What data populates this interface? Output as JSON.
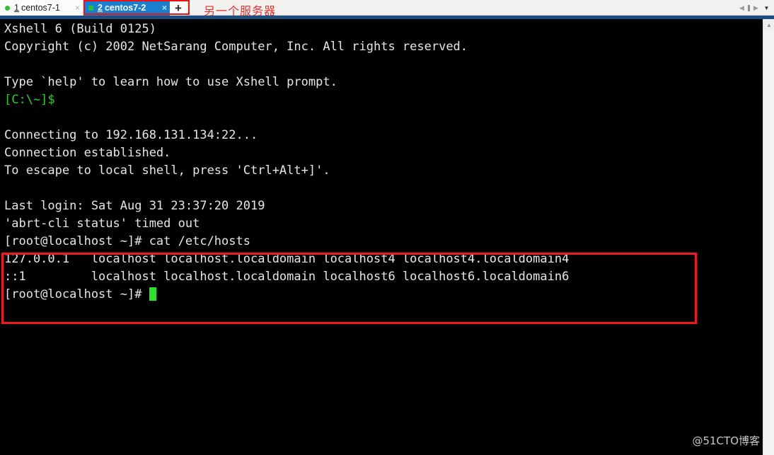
{
  "tabbar": {
    "tabs": [
      {
        "index": "1",
        "label": "centos7-1",
        "close_label": "×",
        "status_icon": "connected-dot-icon",
        "active": false
      },
      {
        "index": "2",
        "label": "centos7-2",
        "close_label": "×",
        "status_icon": "connected-dot-icon",
        "active": true
      }
    ],
    "new_tab_label": "+",
    "nav_prev_label": "◀",
    "nav_next_label": "▶",
    "dropdown_label": "▼",
    "annotation_text": "另一个服务器",
    "annotation_color": "#e8312a"
  },
  "terminal": {
    "lines": [
      {
        "text": "Xshell 6 (Build 0125)",
        "color": "white"
      },
      {
        "text": "Copyright (c) 2002 NetSarang Computer, Inc. All rights reserved.",
        "color": "white"
      },
      {
        "text": "",
        "color": "white"
      },
      {
        "text": "Type `help' to learn how to use Xshell prompt.",
        "color": "white"
      },
      {
        "text": "[C:\\~]$",
        "color": "green"
      },
      {
        "text": "",
        "color": "white"
      },
      {
        "text": "Connecting to 192.168.131.134:22...",
        "color": "white"
      },
      {
        "text": "Connection established.",
        "color": "white"
      },
      {
        "text": "To escape to local shell, press 'Ctrl+Alt+]'.",
        "color": "white"
      },
      {
        "text": "",
        "color": "white"
      },
      {
        "text": "Last login: Sat Aug 31 23:37:20 2019",
        "color": "white"
      },
      {
        "text": "'abrt-cli status' timed out",
        "color": "white"
      },
      {
        "text": "[root@localhost ~]# cat /etc/hosts",
        "color": "white"
      },
      {
        "text": "127.0.0.1   localhost localhost.localdomain localhost4 localhost4.localdomain4",
        "color": "white"
      },
      {
        "text": "::1         localhost localhost.localdomain localhost6 localhost6.localdomain6",
        "color": "white"
      },
      {
        "text": "[root@localhost ~]# ",
        "color": "white",
        "cursor": true
      }
    ],
    "prompt": "[root@localhost ~]#",
    "command": "cat /etc/hosts",
    "host_ip": "192.168.131.134",
    "ssh_port": "22",
    "highlight_color": "#ef1a1a",
    "cursor_color": "#2ae22a",
    "foreground_color": "#e6e6e6",
    "background_color": "#000000"
  },
  "scrollbar": {
    "up_arrow_label": "▲"
  },
  "watermark": {
    "text": "@51CTO博客"
  }
}
